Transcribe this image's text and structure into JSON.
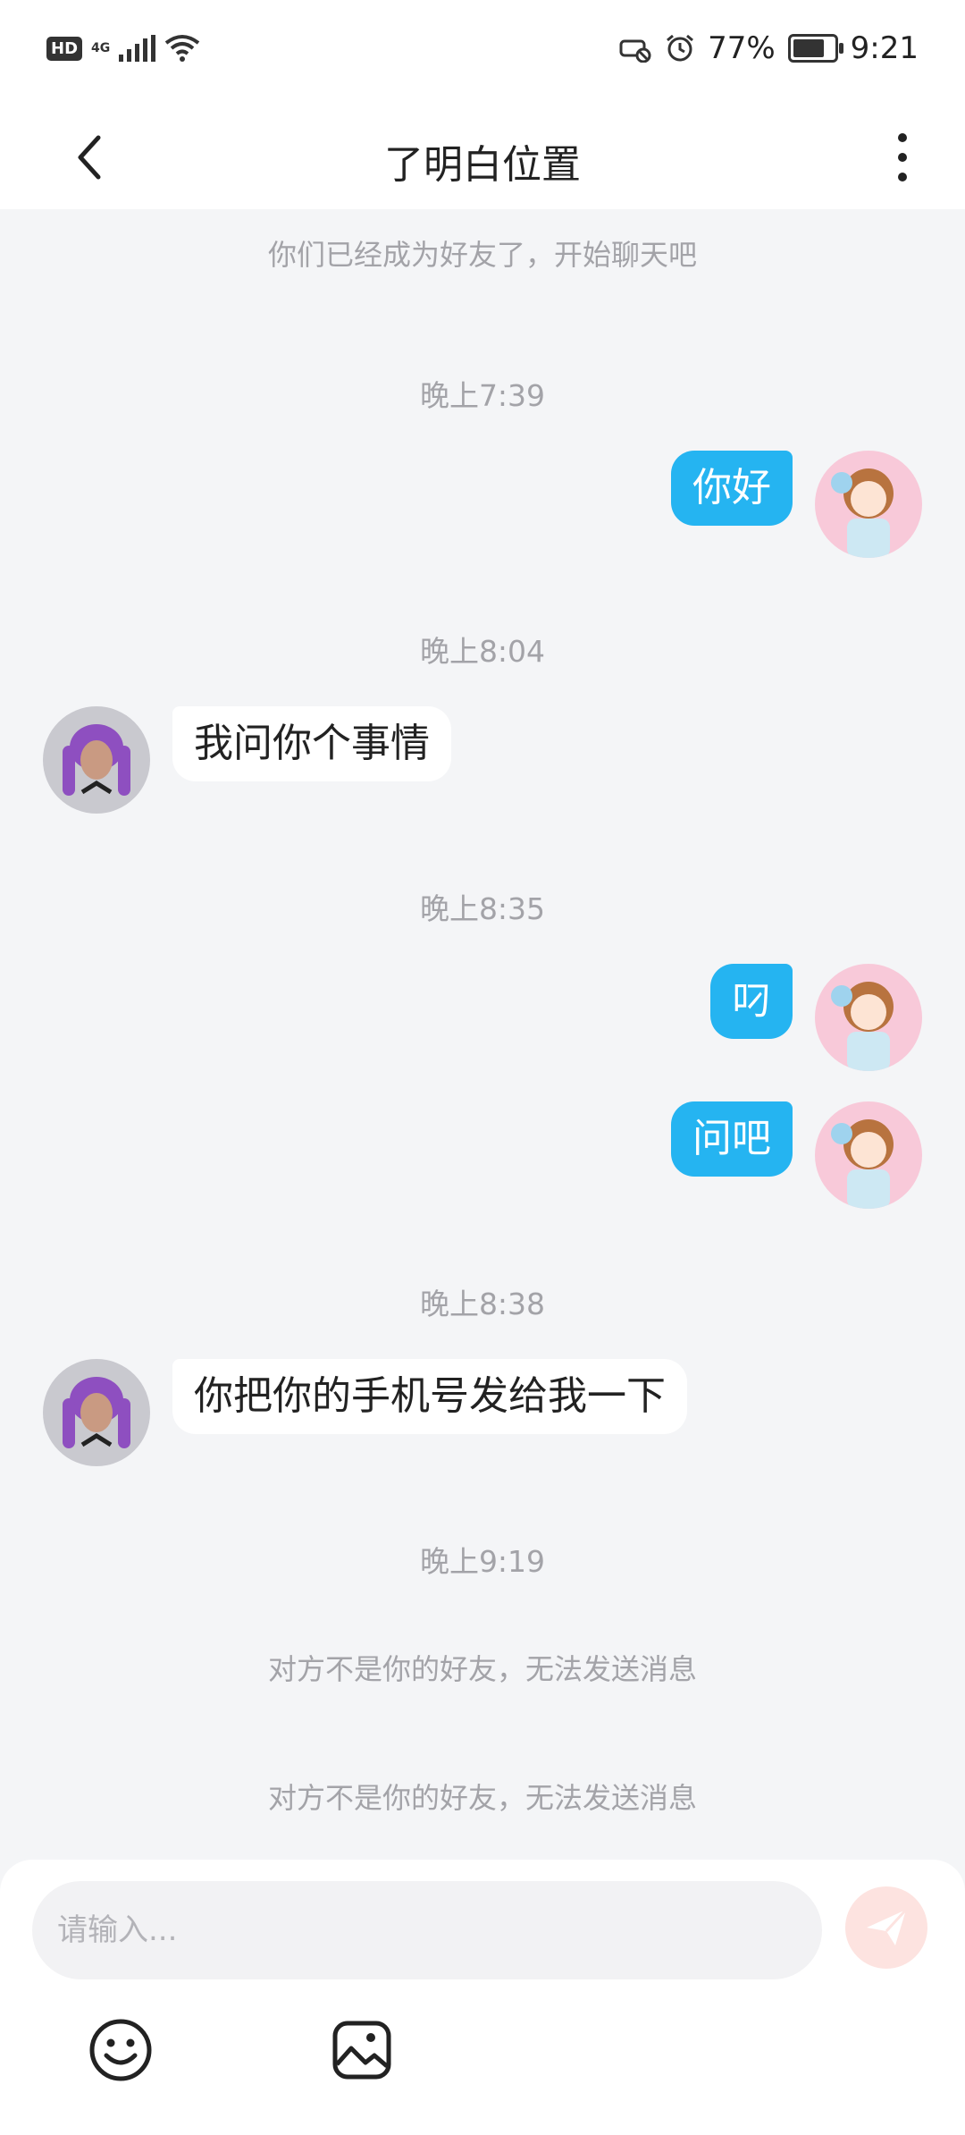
{
  "status_bar": {
    "hd_badge": "HD",
    "network": "4G",
    "battery_percent": "77%",
    "battery_level": 0.77,
    "time": "9:21"
  },
  "header": {
    "title": "了明白位置"
  },
  "chat": {
    "system_notice": "你们已经成为好友了，开始聊天吧",
    "messages": [
      {
        "time": "晚上7:39",
        "side": "right",
        "text": "你好"
      },
      {
        "time": "晚上8:04",
        "side": "left",
        "text": "我问你个事情"
      },
      {
        "time": "晚上8:35",
        "side": "right",
        "text": "叼"
      },
      {
        "side": "right",
        "text": "问吧"
      },
      {
        "time": "晚上8:38",
        "side": "left",
        "text": "你把你的手机号发给我一下"
      }
    ],
    "final_time": "晚上9:19",
    "error_notices": [
      "对方不是你的好友，无法发送消息",
      "对方不是你的好友，无法发送消息"
    ]
  },
  "input": {
    "placeholder": "请输入..."
  },
  "colors": {
    "accent": "#25b4f1",
    "send_disabled": "#fde3e0",
    "background": "#f4f5f7"
  },
  "icons": {
    "back": "chevron-left-icon",
    "more": "more-vertical-icon",
    "send": "paper-plane-icon",
    "emoji": "smiley-icon",
    "image": "image-icon"
  }
}
